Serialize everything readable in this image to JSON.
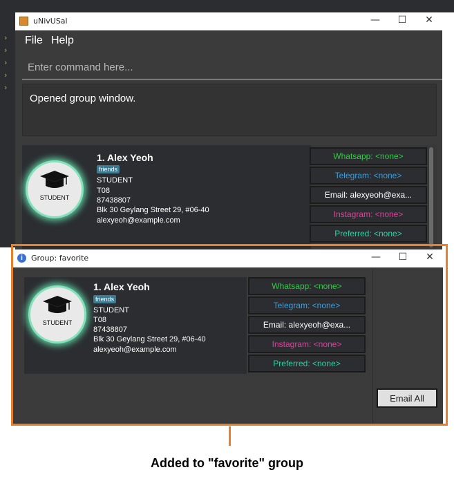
{
  "main_window": {
    "title": "uNivUSal",
    "controls": {
      "minimize": "—",
      "maximize": "☐",
      "close": "✕"
    },
    "menu": [
      {
        "label": "File"
      },
      {
        "label": "Help"
      }
    ],
    "command_placeholder": "Enter command here...",
    "result_text": "Opened group window.",
    "person": {
      "index_name": "1.  Alex Yeoh",
      "tag": "friends",
      "role": "STUDENT",
      "tutorial": "T08",
      "phone": "87438807",
      "address": "Blk 30 Geylang Street 29, #06-40",
      "email": "alexyeoh@example.com",
      "avatar_label": "STUDENT"
    },
    "channels": [
      {
        "label": "Whatsapp: <none>",
        "color": "#2ecc40"
      },
      {
        "label": "Telegram: <none>",
        "color": "#3aa0e0"
      },
      {
        "label": "Email: alexyeoh@exa...",
        "color": "#ffffff"
      },
      {
        "label": "Instagram: <none>",
        "color": "#d9449a"
      },
      {
        "label": "Preferred: <none>",
        "color": "#2fd1a6"
      }
    ]
  },
  "group_window": {
    "title": "Group: favorite",
    "controls": {
      "minimize": "—",
      "maximize": "☐",
      "close": "✕"
    },
    "person": {
      "index_name": "1.  Alex Yeoh",
      "tag": "friends",
      "role": "STUDENT",
      "tutorial": "T08",
      "phone": "87438807",
      "address": "Blk 30 Geylang Street 29, #06-40",
      "email": "alexyeoh@example.com",
      "avatar_label": "STUDENT"
    },
    "channels": [
      {
        "label": "Whatsapp: <none>",
        "color": "#2ecc40"
      },
      {
        "label": "Telegram: <none>",
        "color": "#3aa0e0"
      },
      {
        "label": "Email: alexyeoh@exa...",
        "color": "#ffffff"
      },
      {
        "label": "Instagram: <none>",
        "color": "#d9449a"
      },
      {
        "label": "Preferred: <none>",
        "color": "#2fd1a6"
      }
    ],
    "email_all_label": "Email All"
  },
  "caption": "Added to \"favorite\" group",
  "colors": {
    "highlight": "#e87f2a",
    "avatar_glow": "#5fd3a3",
    "tag_bg": "#3e7b91"
  }
}
